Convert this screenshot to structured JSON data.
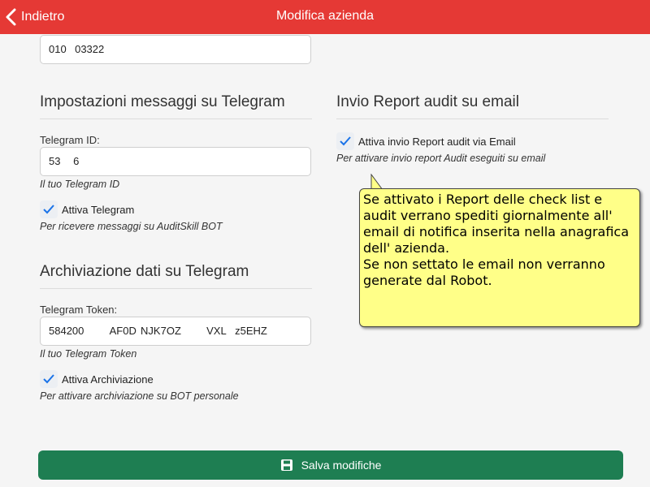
{
  "header": {
    "back_label": "Indietro",
    "title": "Modifica azienda",
    "color": "#e53935"
  },
  "top_field": {
    "value": "010    03322"
  },
  "telegram_section": {
    "title": "Impostazioni messaggi su Telegram",
    "id_label": "Telegram ID:",
    "id_value": "53      6  ",
    "id_hint": "Il tuo Telegram ID",
    "enable_label": "Attiva Telegram",
    "enable_checked": true,
    "enable_hint": "Per ricevere messaggi su AuditSkill BOT"
  },
  "archive_section": {
    "title": "Archiviazione dati su Telegram",
    "token_label": "Telegram Token:",
    "token_value": "584200            AF0D  NJK7OZ            VXL    z5EHZ",
    "token_hint": "Il tuo Telegram Token",
    "enable_label": "Attiva Archiviazione",
    "enable_checked": true,
    "enable_hint": "Per attivare archiviazione su BOT personale"
  },
  "email_section": {
    "title": "Invio Report audit su email",
    "enable_label": "Attiva invio Report audit via Email",
    "enable_checked": true,
    "enable_hint": "Per attivare invio report Audit eseguiti su email"
  },
  "tooltip": {
    "lines": [
      "Se attivato i Report delle check list e",
      "audit verrano spediti giornalmente all'",
      "email di notifica inserita nella anagrafica",
      "dell' azienda.",
      "Se non settato le email non verranno",
      "generate dal Robot."
    ],
    "background": "#ffff88"
  },
  "save_button": {
    "label": "Salva modifiche",
    "color": "#1e7e52",
    "icon": "save-icon"
  }
}
